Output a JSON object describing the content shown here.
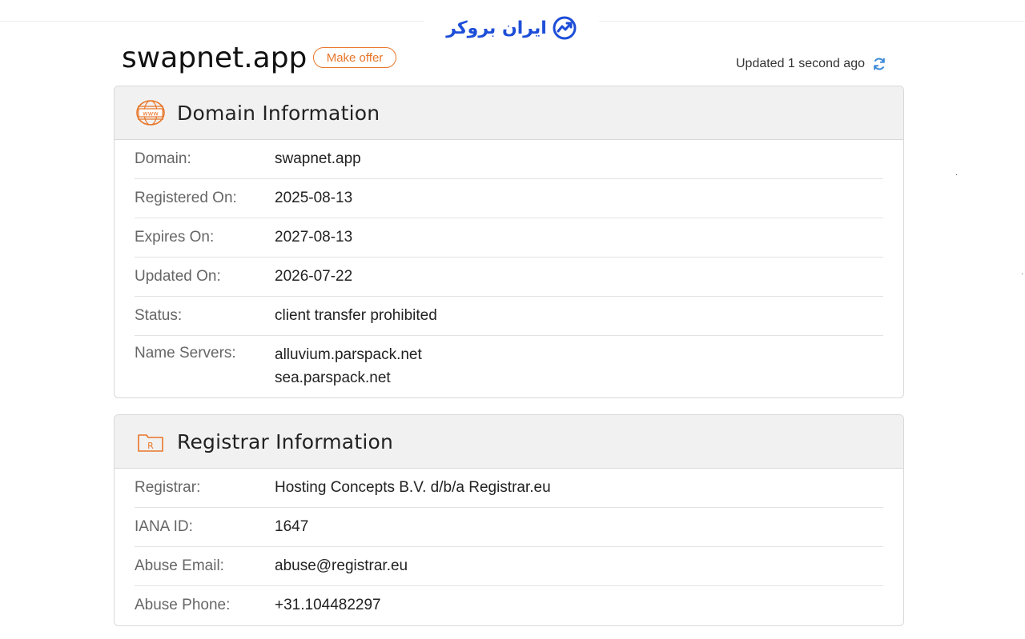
{
  "brand": {
    "name": "ایران بروکر"
  },
  "domain": {
    "name": "swapnet.app",
    "offer_label": "Make offer",
    "updated_text": "Updated 1 second ago"
  },
  "domain_info": {
    "title": "Domain Information",
    "rows": [
      {
        "label": "Domain:",
        "value": "swapnet.app"
      },
      {
        "label": "Registered On:",
        "value": "2025-08-13"
      },
      {
        "label": "Expires On:",
        "value": "2027-08-13"
      },
      {
        "label": "Updated On:",
        "value": "2026-07-22"
      },
      {
        "label": "Status:",
        "value": "client transfer prohibited"
      }
    ],
    "name_servers_label": "Name Servers:",
    "name_servers": [
      "alluvium.parspack.net",
      "sea.parspack.net"
    ]
  },
  "registrar_info": {
    "title": "Registrar Information",
    "rows": [
      {
        "label": "Registrar:",
        "value": "Hosting Concepts B.V. d/b/a Registrar.eu"
      },
      {
        "label": "IANA ID:",
        "value": "1647"
      },
      {
        "label": "Abuse Email:",
        "value": "abuse@registrar.eu"
      },
      {
        "label": "Abuse Phone:",
        "value": "+31.104482297"
      }
    ]
  },
  "colors": {
    "accent": "#e8762a",
    "brand": "#1d4ed8",
    "header_bg": "#f1f1f1"
  },
  "icons": {
    "domain_card": "www-globe-icon",
    "registrar_card": "registrar-folder-icon",
    "refresh": "refresh-icon",
    "brand_logo": "chart-up-logo-icon"
  }
}
